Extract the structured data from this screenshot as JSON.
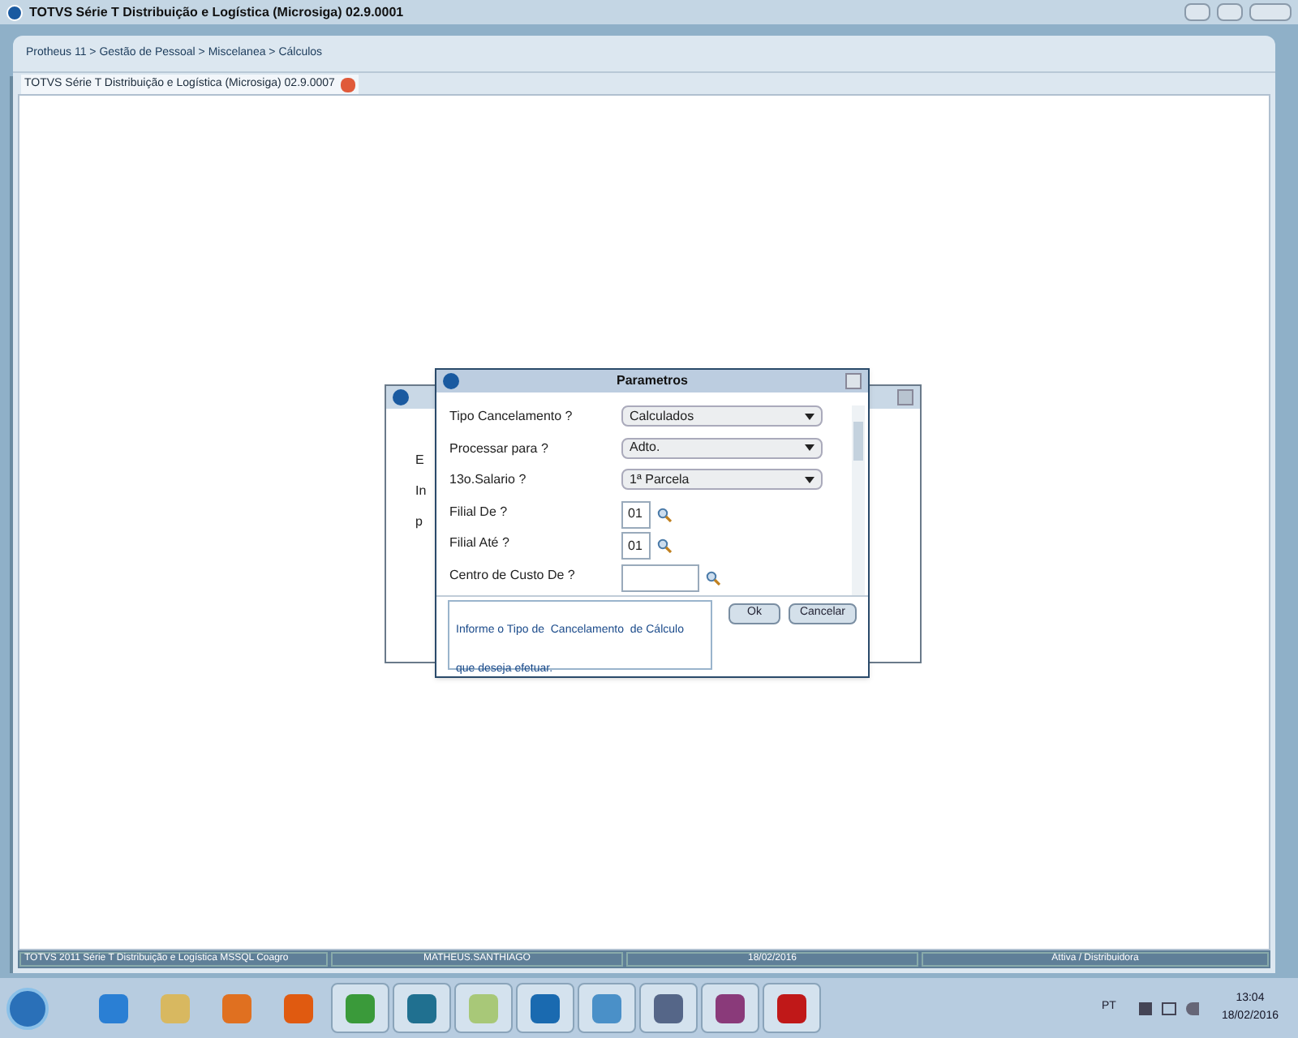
{
  "window": {
    "title": "TOTVS Série T Distribuição e Logística (Microsiga) 02.9.0001"
  },
  "breadcrumb": "Protheus 11 > Gestão de Pessoal > Miscelanea > Cálculos",
  "tabs": [
    {
      "label": "TOTVS Série T Distribuição e Logística (Microsiga) 02.9.0007",
      "selected": true
    }
  ],
  "back_dialog": {
    "lines": [
      "E",
      "In",
      "p"
    ]
  },
  "dialog": {
    "title": "Parametros",
    "params": [
      {
        "kind": "select",
        "label": "Tipo Cancelamento ?",
        "value": "Calculados"
      },
      {
        "kind": "select",
        "label": "Processar para ?",
        "value": "Adto."
      },
      {
        "kind": "select",
        "label": "13o.Salario ?",
        "value": "1ª Parcela"
      },
      {
        "kind": "lookup",
        "label": "Filial De ?",
        "value": "01"
      },
      {
        "kind": "lookup",
        "label": "Filial Até ?",
        "value": "01"
      },
      {
        "kind": "lookup",
        "label": "Centro de Custo De ?"
      }
    ],
    "help": "Informe o Tipo de  Cancelamento  de Cálculo que deseja efetuar.",
    "buttons": [
      "Ok",
      "Cancelar"
    ]
  },
  "status_bar": [
    "TOTVS 2011 Série T Distribuição e Logística MSSQL Coagro",
    "MATHEUS.SANTHIAGO",
    "18/02/2016",
    "Attiva / Distribuidora"
  ],
  "taskbar": {
    "language": "PT",
    "time": "13:04",
    "date": "18/02/2016"
  }
}
